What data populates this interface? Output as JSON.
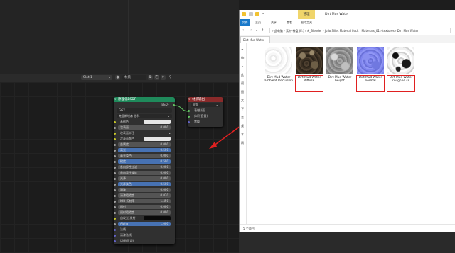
{
  "blender": {
    "header": {
      "layer_value": "Slot 1",
      "material_value": "材质",
      "icons": [
        "expand-icon",
        "material-ball-icon",
        "copy-icon",
        "pin-icon"
      ]
    },
    "principled": {
      "title": "原理化BSDF",
      "output": "BSDF",
      "dropdown1": "GGX",
      "dropdown2": "克里斯坦森-伯科",
      "rows": [
        {
          "label": "基础色",
          "kind": "swatch-light"
        },
        {
          "label": "次表面",
          "kind": "field",
          "value": "0.000"
        },
        {
          "label": "次表面半径",
          "kind": "dropdown"
        },
        {
          "label": "次表面颜色",
          "kind": "swatch-light"
        },
        {
          "label": "金属度",
          "kind": "field",
          "value": "0.000"
        },
        {
          "label": "高光",
          "kind": "field-blue",
          "value": "0.500"
        },
        {
          "label": "高光染色",
          "kind": "field",
          "value": "0.000"
        },
        {
          "label": "糙度",
          "kind": "field-blue",
          "value": "0.500"
        },
        {
          "label": "各向异性过滤",
          "kind": "field",
          "value": "0.000"
        },
        {
          "label": "各向异性旋转",
          "kind": "field",
          "value": "0.000"
        },
        {
          "label": "光泽",
          "kind": "field",
          "value": "0.000"
        },
        {
          "label": "光泽染色",
          "kind": "field-blue",
          "value": "0.500"
        },
        {
          "label": "清漆",
          "kind": "field",
          "value": "0.000"
        },
        {
          "label": "清漆粗糙度",
          "kind": "field",
          "value": "0.030"
        },
        {
          "label": "IOR 折射率",
          "kind": "field",
          "value": "1.450"
        },
        {
          "label": "透射",
          "kind": "field",
          "value": "0.000"
        },
        {
          "label": "透射粗糙度",
          "kind": "field",
          "value": "0.000"
        },
        {
          "label": "自发光(发射)",
          "kind": "swatch-dark"
        },
        {
          "label": "Alpha",
          "kind": "field-blue",
          "value": "1.000"
        },
        {
          "label": "法线",
          "kind": "plain"
        },
        {
          "label": "清漆法线",
          "kind": "plain"
        },
        {
          "label": "切线(正切)",
          "kind": "plain"
        }
      ]
    },
    "output_node": {
      "title": "材质输出",
      "dropdown": "全部",
      "rows": [
        "表(曲)面",
        "体积(音量)",
        "置换"
      ]
    }
  },
  "explorer": {
    "manage_tab": "管理",
    "window_title": "Dirt Mus Water",
    "ribbon": {
      "file": "文件",
      "home": "主页",
      "share": "共享",
      "view": "查看",
      "picture_tools": "图片工具"
    },
    "address": {
      "segments": [
        "此电脑",
        "素材-神盘 (E:)",
        "#_Blender",
        "Julio Sillet Material Pack",
        "Materials_01",
        "textures",
        "Dirt Mus Water"
      ],
      "separator": " › "
    },
    "tab_label": "Dirt Mus Water",
    "sidebar": [
      "★",
      "On",
      "☁",
      "此",
      "视",
      "图",
      "文",
      "下",
      "音",
      "桌",
      "本",
      "网"
    ],
    "files": [
      {
        "name": "Dirt Mud Water ambient Occlusion",
        "selected": false,
        "thumb": "ao"
      },
      {
        "name": "Dirt Mud Water diffuse",
        "selected": true,
        "thumb": "diffuse"
      },
      {
        "name": "Dirt Mud Water height",
        "selected": false,
        "thumb": "height"
      },
      {
        "name": "Dirt Mud Water normal",
        "selected": true,
        "thumb": "normal"
      },
      {
        "name": "Dirt Mud Water roughne ss",
        "selected": true,
        "thumb": "rough"
      }
    ],
    "status": "5 个项目"
  },
  "colors": {
    "principled_header": "#1f8a5b",
    "output_header": "#8a2a2a",
    "annotation": "#e02020",
    "socket_yellow": "#c7c729",
    "socket_purple": "#6363c7",
    "socket_green": "#63c763",
    "socket_gray": "#a1a1a1"
  }
}
